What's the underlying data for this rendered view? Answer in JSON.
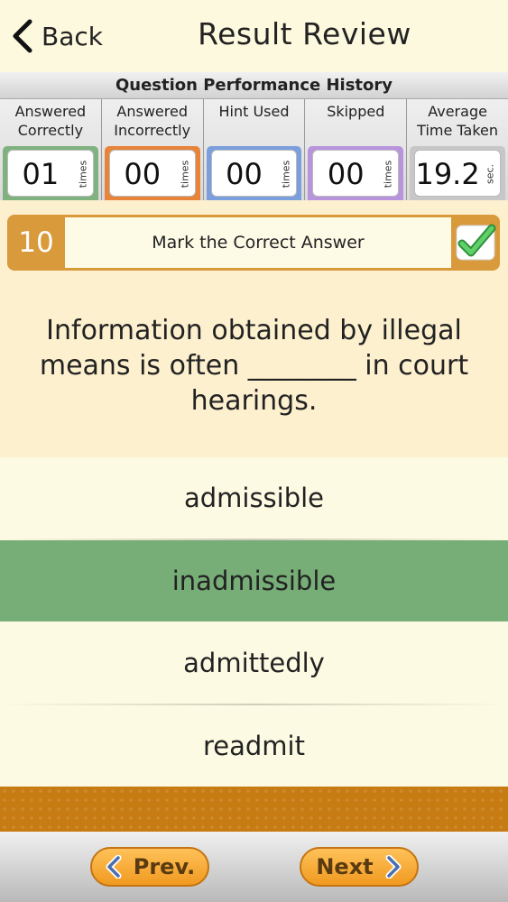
{
  "header": {
    "back_label": "Back",
    "title": "Result Review"
  },
  "performance": {
    "title": "Question Performance History",
    "columns": [
      {
        "label_line1": "Answered",
        "label_line2": "Correctly",
        "value": "01",
        "unit": "times",
        "color": "#7fb27f"
      },
      {
        "label_line1": "Answered",
        "label_line2": "Incorrectly",
        "value": "00",
        "unit": "times",
        "color": "#e8833a"
      },
      {
        "label_line1": "Hint Used",
        "label_line2": "",
        "value": "00",
        "unit": "times",
        "color": "#7a9fdc"
      },
      {
        "label_line1": "Skipped",
        "label_line2": "",
        "value": "00",
        "unit": "times",
        "color": "#b894dc"
      },
      {
        "label_line1": "Average",
        "label_line2": "Time Taken",
        "value": "19.2",
        "unit": "sec.",
        "color": "#c7c7c7"
      }
    ]
  },
  "question": {
    "number": "10",
    "type_label": "Mark the Correct Answer",
    "status_icon": "checkmark-icon",
    "text": "Information obtained by illegal means is often ________ in court hearings."
  },
  "options": [
    {
      "label": "admissible",
      "selected": false
    },
    {
      "label": "inadmissible",
      "selected": true
    },
    {
      "label": "admittedly",
      "selected": false
    },
    {
      "label": "readmit",
      "selected": false
    }
  ],
  "footer": {
    "prev_label": "Prev.",
    "next_label": "Next"
  },
  "colors": {
    "background": "#fdfae3",
    "accent_orange": "#d99a3c",
    "selected_green": "#77ad77",
    "check_green": "#3fae4a"
  }
}
